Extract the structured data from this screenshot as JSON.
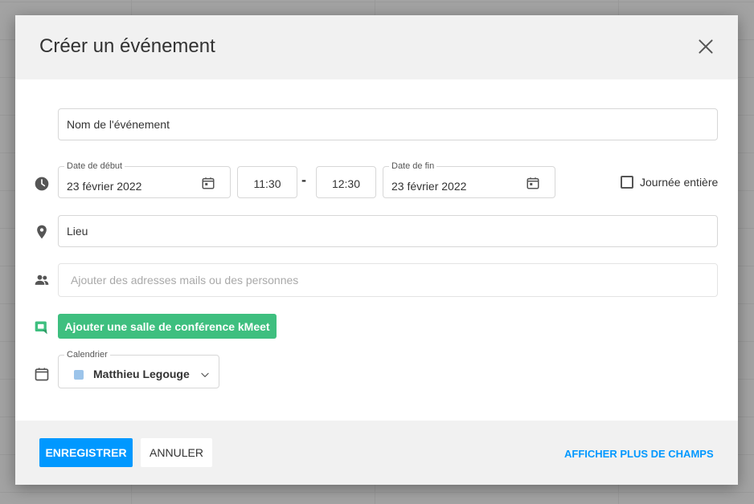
{
  "dialog": {
    "title": "Créer un événement"
  },
  "event_name": {
    "placeholder": "Nom de l'événement"
  },
  "schedule": {
    "start_date_label": "Date de début",
    "start_date_value": "23 février 2022",
    "start_time": "11:30",
    "separator": "-",
    "end_time": "12:30",
    "end_date_label": "Date de fin",
    "end_date_value": "23 février 2022",
    "all_day_label": "Journée entière",
    "all_day_checked": false
  },
  "location": {
    "placeholder": "Lieu"
  },
  "attendees": {
    "placeholder": "Ajouter des adresses mails ou des personnes"
  },
  "kmeet": {
    "button_label": "Ajouter une salle de conférence kMeet",
    "color": "#3ebf7f"
  },
  "calendar": {
    "label": "Calendrier",
    "selected": "Matthieu Legouge",
    "swatch_color": "#9cc4ea"
  },
  "footer": {
    "save_label": "ENREGISTRER",
    "cancel_label": "ANNULER",
    "more_fields_label": "AFFICHER PLUS DE CHAMPS",
    "accent": "#0098ff"
  },
  "icons": [
    "close-icon",
    "clock-icon",
    "calendar-icon",
    "location-pin-icon",
    "people-icon",
    "kmeet-icon",
    "chevron-down-icon"
  ]
}
